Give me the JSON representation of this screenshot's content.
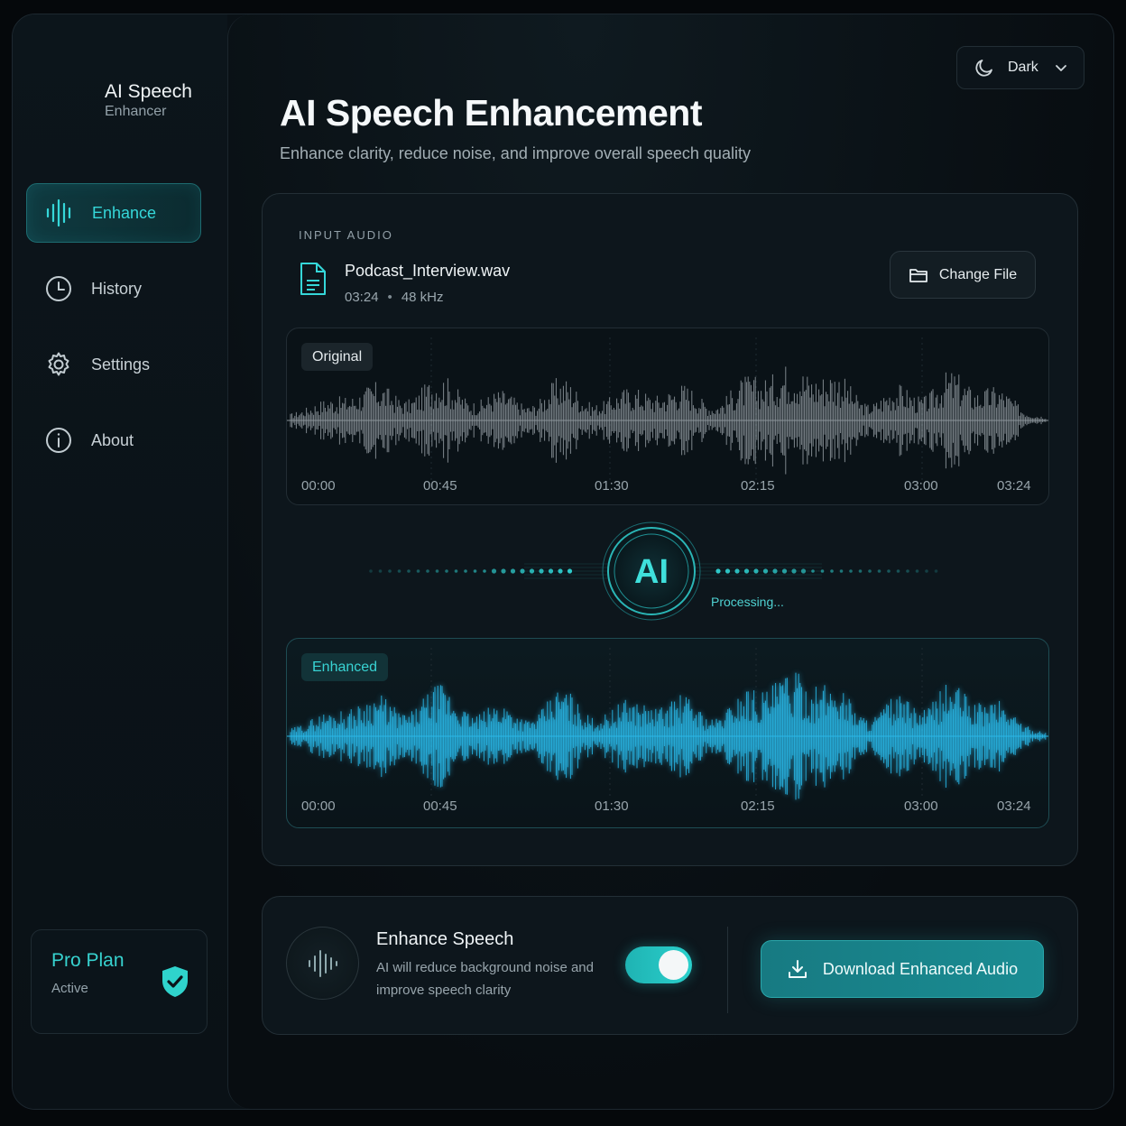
{
  "brand": {
    "title": "AI Speech",
    "subtitle": "Enhancer"
  },
  "nav": [
    {
      "label": "Enhance",
      "icon": "waveform-icon",
      "active": true
    },
    {
      "label": "History",
      "icon": "clock-icon",
      "active": false
    },
    {
      "label": "Settings",
      "icon": "gear-icon",
      "active": false
    },
    {
      "label": "About",
      "icon": "info-icon",
      "active": false
    }
  ],
  "plan": {
    "title": "Pro Plan",
    "status": "Active",
    "icon": "shield-check-icon"
  },
  "theme": {
    "label": "Dark",
    "icon": "moon-icon"
  },
  "header": {
    "title": "AI Speech Enhancement",
    "subtitle": "Enhance clarity, reduce noise, and improve overall speech quality"
  },
  "input": {
    "section_label": "INPUT AUDIO",
    "file_name": "Podcast_Interview.wav",
    "duration": "03:24",
    "sample_rate": "48 kHz",
    "change_label": "Change File"
  },
  "original": {
    "tag": "Original"
  },
  "enhanced": {
    "tag": "Enhanced"
  },
  "timeline": [
    "00:00",
    "00:45",
    "01:30",
    "02:15",
    "03:00",
    "03:24"
  ],
  "ai": {
    "badge": "AI",
    "status": "Processing..."
  },
  "enhance": {
    "title": "Enhance Speech",
    "description": "AI will reduce background noise and improve speech clarity",
    "toggle_on": true
  },
  "download": {
    "label": "Download Enhanced Audio",
    "icon": "download-icon"
  },
  "colors": {
    "accent": "#35d7d9",
    "wave_original": "#8a9399",
    "wave_enhanced": "#2ab8e8",
    "background": "#0a1116"
  }
}
